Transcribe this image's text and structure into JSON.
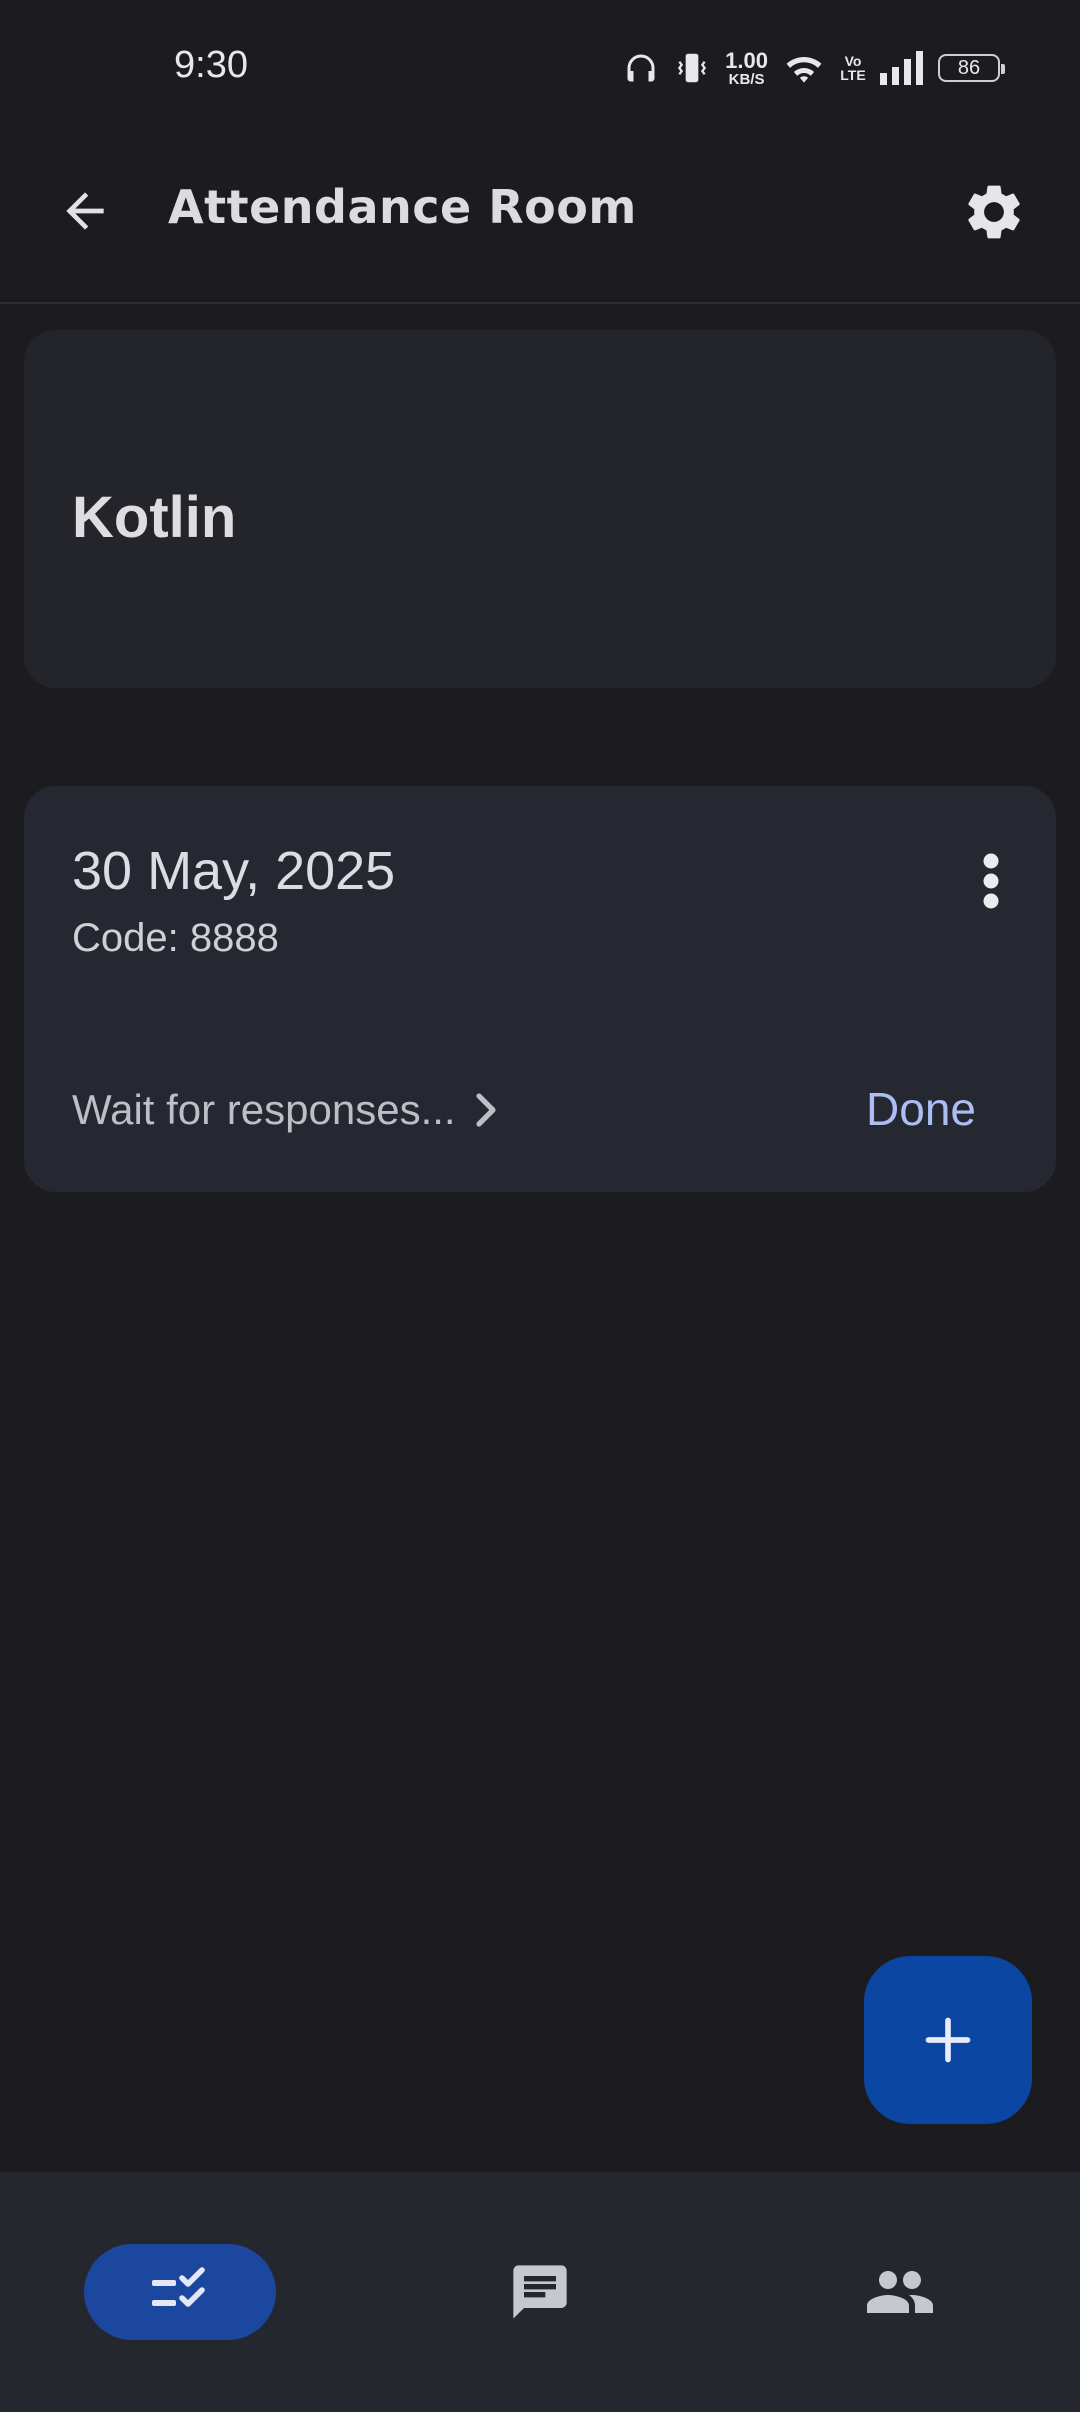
{
  "status_bar": {
    "time": "9:30",
    "net_speed_value": "1.00",
    "net_speed_unit": "KB/S",
    "volte": "Vo LTE",
    "battery": "86",
    "icons": [
      "headphones-icon",
      "vibrate-icon",
      "wifi-icon",
      "signal-icon",
      "battery-icon"
    ]
  },
  "app_bar": {
    "title": "Attendance Room",
    "back_icon": "arrow-back-icon",
    "settings_icon": "gear-icon"
  },
  "class_card": {
    "name": "Kotlin"
  },
  "session": {
    "date": "30 May, 2025",
    "code": "Code: 8888",
    "status_link": "Wait for responses...",
    "action": "Done",
    "menu_icon": "more-vert-icon"
  },
  "fab": {
    "icon": "plus-icon"
  },
  "bottom_nav": {
    "items": [
      {
        "icon": "checklist-icon",
        "active": true
      },
      {
        "icon": "chat-icon",
        "active": false
      },
      {
        "icon": "people-icon",
        "active": false
      }
    ]
  },
  "colors": {
    "background": "#1c1c20",
    "card": "#24252b",
    "accent": "#0b46a3",
    "active_nav": "#1c479e",
    "done_text": "#aebcf4"
  }
}
